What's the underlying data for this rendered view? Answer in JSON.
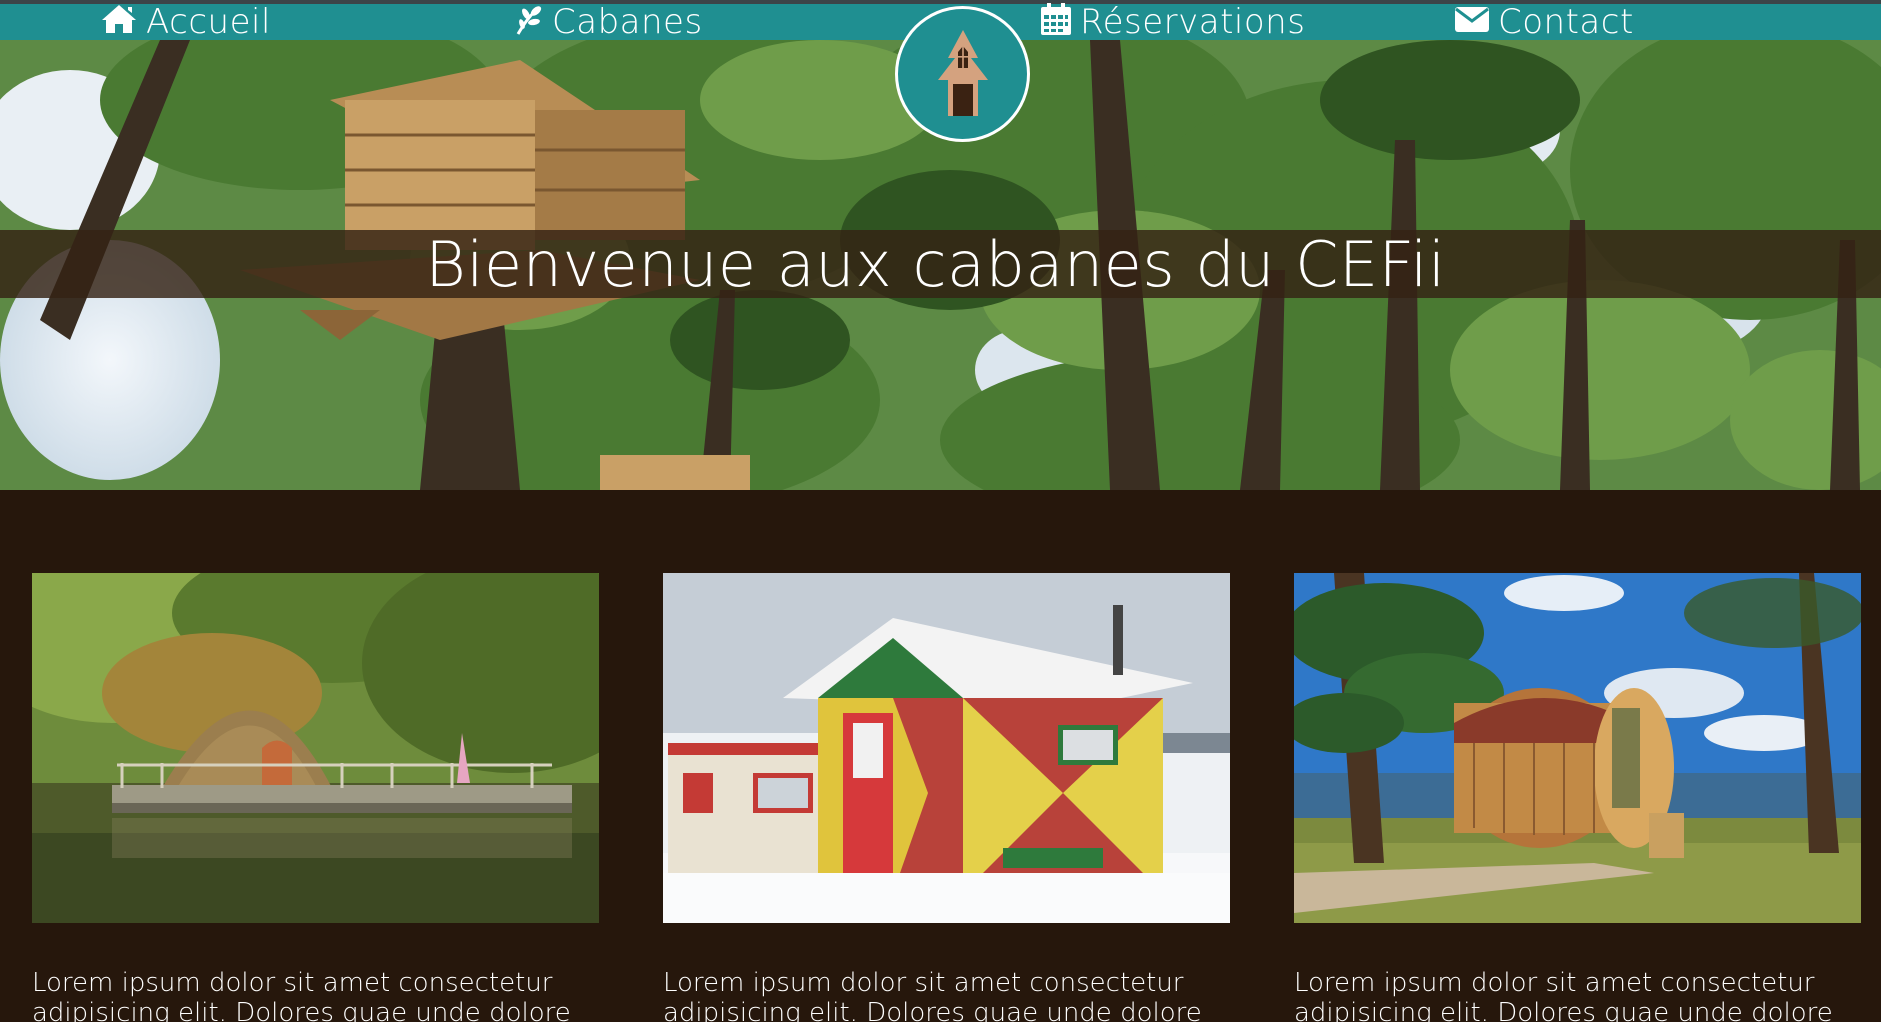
{
  "nav": {
    "items": [
      {
        "label": "Accueil",
        "icon": "home-icon"
      },
      {
        "label": "Cabanes",
        "icon": "leaf-icon"
      },
      {
        "label": "Réservations",
        "icon": "calendar-icon"
      },
      {
        "label": "Contact",
        "icon": "envelope-icon"
      }
    ],
    "logo": "treehouse-logo-icon"
  },
  "hero": {
    "title": "Bienvenue aux cabanes du CEFii"
  },
  "cards": [
    {
      "image": "floating-wicker-cabin-photo",
      "text": "Lorem ipsum dolor sit amet consectetur adipisicing elit. Dolores quae unde dolore"
    },
    {
      "image": "colorful-ice-fishing-cabin-photo",
      "text": "Lorem ipsum dolor sit amet consectetur adipisicing elit. Dolores quae unde dolore"
    },
    {
      "image": "barrel-cabin-seaside-photo",
      "text": "Lorem ipsum dolor sit amet consectetur adipisicing elit. Dolores quae unde dolore"
    }
  ],
  "colors": {
    "nav_bg": "#1f8f91",
    "page_bg": "#26170c",
    "hero_band": "#342214",
    "text": "#ffffff"
  }
}
